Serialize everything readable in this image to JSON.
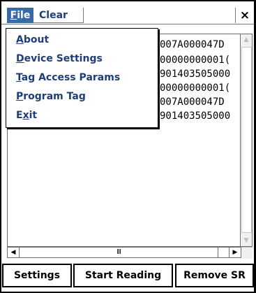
{
  "menubar": {
    "file_label_first": "F",
    "file_label_rest": "ile",
    "clear_label": "Clear",
    "close_label": "×"
  },
  "menu_items": [
    {
      "underlined": "A",
      "rest": "bout"
    },
    {
      "underlined": "D",
      "rest": "evice Settings"
    },
    {
      "underlined": "T",
      "rest": "ag Access Params"
    },
    {
      "underlined": "P",
      "rest": "rogram Tag"
    },
    {
      "underlined": "E",
      "rest": "xit",
      "prefix": ""
    }
  ],
  "list": {
    "rows": [
      "007A000047D",
      "00000000001(",
      "901403505000",
      "00000000001(",
      "007A000047D",
      "901403505000"
    ]
  },
  "hscroll": {
    "thumb_grip": "III",
    "left_arrow": "◀",
    "right_arrow": "▶"
  },
  "vscroll": {
    "up_arrow": "▲",
    "down_arrow": "▼"
  },
  "buttons": {
    "settings": "Settings",
    "start_reading": "Start Reading",
    "remove_sr": "Remove SR"
  },
  "colors": {
    "menu_highlight": "#3a6aa5",
    "menu_text": "#1f3d7a"
  }
}
